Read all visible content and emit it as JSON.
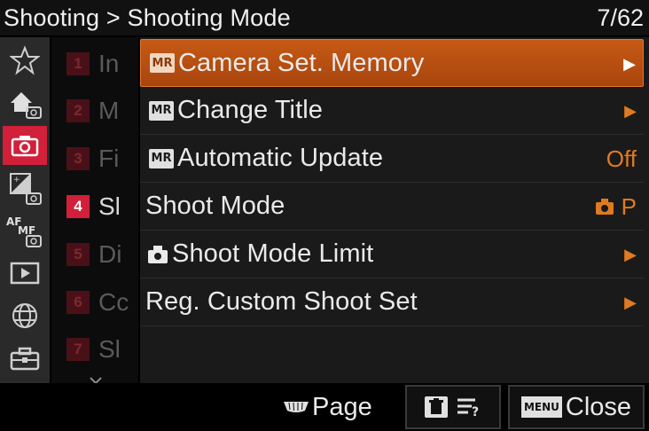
{
  "header": {
    "breadcrumb": "Shooting > Shooting Mode",
    "page_indicator": "7/62"
  },
  "sidebar": {
    "items": [
      {
        "icon": "star-icon"
      },
      {
        "icon": "home-camera-icon"
      },
      {
        "icon": "camera-icon",
        "active": true
      },
      {
        "icon": "exposure-camera-icon"
      },
      {
        "icon": "af-mf-camera-icon",
        "text": "AF",
        "subtext": "MF"
      },
      {
        "icon": "playback-icon"
      },
      {
        "icon": "globe-icon"
      },
      {
        "icon": "toolbox-icon"
      }
    ]
  },
  "subnav": {
    "items": [
      {
        "num": "1",
        "label": "In"
      },
      {
        "num": "2",
        "label": "M"
      },
      {
        "num": "3",
        "label": "Fi"
      },
      {
        "num": "4",
        "label": "Sl",
        "active": true
      },
      {
        "num": "5",
        "label": "Di"
      },
      {
        "num": "6",
        "label": "Cc"
      },
      {
        "num": "7",
        "label": "Sl"
      }
    ]
  },
  "menu": {
    "items": [
      {
        "icon": "MR",
        "label": "Camera Set. Memory",
        "value": "▶",
        "selected": true
      },
      {
        "icon": "MR",
        "label": "Change Title",
        "value": "▶"
      },
      {
        "icon": "MR",
        "label": "Automatic Update",
        "value": "Off"
      },
      {
        "label": "Shoot Mode",
        "value": "P"
      },
      {
        "label": "Shoot Mode Limit",
        "value": "▶"
      },
      {
        "label": "Reg. Custom Shoot Set",
        "value": "▶"
      }
    ]
  },
  "footer": {
    "page_label": "Page",
    "menu_tag": "MENU",
    "close_label": "Close"
  },
  "colors": {
    "accent_red": "#d21f3a",
    "selection_orange": "#b84e10",
    "value_orange": "#e07a20"
  }
}
